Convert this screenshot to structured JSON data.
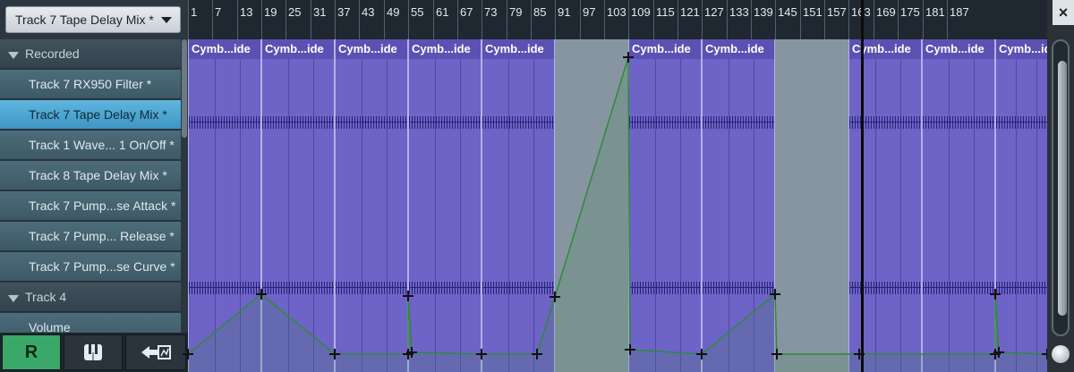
{
  "app": {
    "track_selector": "Track 7 Tape Delay Mix *"
  },
  "sidebar": {
    "sections": [
      {
        "label": "Recorded",
        "type": "header"
      },
      {
        "label": "Track 7 RX950 Filter *",
        "type": "item"
      },
      {
        "label": "Track 7 Tape Delay Mix *",
        "type": "item",
        "selected": true
      },
      {
        "label": "Track 1 Wave... 1 On/Off *",
        "type": "item"
      },
      {
        "label": "Track 8 Tape Delay Mix *",
        "type": "item"
      },
      {
        "label": "Track 7 Pump...se Attack *",
        "type": "item"
      },
      {
        "label": "Track 7 Pump... Release *",
        "type": "item"
      },
      {
        "label": "Track 7 Pump...se Curve *",
        "type": "item"
      },
      {
        "label": "Track 4",
        "type": "header"
      },
      {
        "label": "Volume",
        "type": "item"
      }
    ]
  },
  "toolbar": {
    "record_label": "R",
    "keyboard_icon": "piano-keys-icon",
    "route_icon": "route-arrow-icon"
  },
  "ruler": {
    "labels": [
      "1",
      "7",
      "13",
      "19",
      "25",
      "31",
      "37",
      "43",
      "49",
      "55",
      "61",
      "67",
      "73",
      "79",
      "85",
      "91",
      "97",
      "103",
      "109",
      "115",
      "121",
      "127",
      "133",
      "139",
      "145",
      "151",
      "157",
      "163",
      "169",
      "175",
      "181",
      "187"
    ]
  },
  "clips": [
    {
      "title": "Cymb...ide"
    },
    {
      "title": "Cymb...ide"
    },
    {
      "title": "Cymb...ide"
    },
    {
      "title": "Cymb...ide"
    },
    {
      "title": "Cymb...ide"
    },
    {
      "title": "Cymb...ide"
    },
    {
      "title": "Cymb...ide"
    },
    {
      "title": "Cymb...ide"
    },
    {
      "title": "Cymb...ide"
    },
    {
      "title": "Cymb...ide"
    }
  ],
  "colors": {
    "clip": "#6e63c6",
    "automation_line": "#2f8a3c",
    "selected_row": "#4fa6d2",
    "record_button": "#3aa868"
  },
  "window": {
    "close_icon": "close-icon"
  }
}
